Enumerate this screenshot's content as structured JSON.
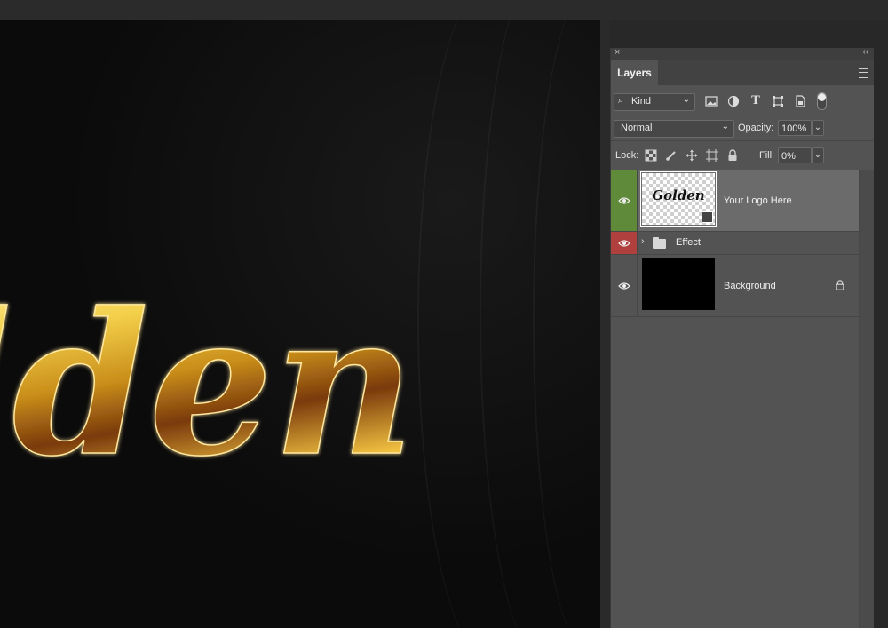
{
  "panel": {
    "close_glyph": "×",
    "collapse_glyph": "‹‹",
    "tab_label": "Layers"
  },
  "filter": {
    "kind_label": "Kind",
    "icons": [
      "image-filter-icon",
      "adjustment-filter-icon",
      "type-filter-icon",
      "shape-filter-icon",
      "smart-object-filter-icon"
    ]
  },
  "blend": {
    "mode": "Normal",
    "opacity_label": "Opacity:",
    "opacity_value": "100%"
  },
  "lock": {
    "label": "Lock:",
    "fill_label": "Fill:",
    "fill_value": "0%"
  },
  "layers": [
    {
      "name": "Your Logo Here",
      "thumb_text": "Golden",
      "selected": true,
      "eye_color": "#5e8a3a"
    },
    {
      "name": "Effect",
      "type": "group",
      "eye_color": "#b0403e"
    },
    {
      "name": "Background",
      "locked": true
    }
  ],
  "canvas": {
    "art_text": "lden"
  },
  "colors": {
    "panel_bg": "#535353",
    "selected_row": "#6b6b6b",
    "green_tag": "#5e8a3a",
    "red_tag": "#b0403e"
  }
}
